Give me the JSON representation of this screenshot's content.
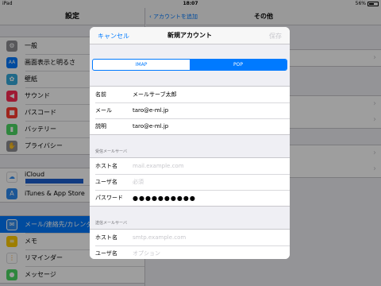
{
  "status_bar": {
    "device": "iPad",
    "time": "18:07",
    "battery": "56%"
  },
  "left_pane": {
    "title": "設定",
    "group1": [
      {
        "label": "一般",
        "icon": "gear-icon",
        "color": "#8e8e93"
      },
      {
        "label": "画面表示と明るさ",
        "icon": "brightness-icon",
        "color": "#007aff"
      },
      {
        "label": "壁紙",
        "icon": "wallpaper-icon",
        "color": "#34aadc"
      },
      {
        "label": "サウンド",
        "icon": "speaker-icon",
        "color": "#ff2d55"
      },
      {
        "label": "パスコード",
        "icon": "lock-icon",
        "color": "#ff3b30"
      },
      {
        "label": "バッテリー",
        "icon": "battery-icon",
        "color": "#4cd964"
      },
      {
        "label": "プライバシー",
        "icon": "hand-icon",
        "color": "#8e8e93"
      }
    ],
    "group2": [
      {
        "label": "iCloud",
        "icon": "cloud-icon",
        "color": "#ffffff"
      },
      {
        "label": "iTunes & App Store",
        "icon": "appstore-icon",
        "color": "#2e8cf0"
      }
    ],
    "group3": [
      {
        "label": "メール/連絡先/カレンダー",
        "icon": "mail-icon",
        "color": "#2e8cf0",
        "active": true
      },
      {
        "label": "メモ",
        "icon": "notes-icon",
        "color": "#ffcc00"
      },
      {
        "label": "リマインダー",
        "icon": "reminders-icon",
        "color": "#ffffff"
      },
      {
        "label": "メッセージ",
        "icon": "messages-icon",
        "color": "#4cd964"
      }
    ]
  },
  "right_pane": {
    "back_label": "アカウントを追加",
    "title": "その他"
  },
  "modal": {
    "cancel": "キャンセル",
    "title": "新規アカウント",
    "save": "保存",
    "segments": [
      "IMAP",
      "POP"
    ],
    "selected_segment": "POP",
    "account": [
      {
        "label": "名前",
        "value": "メールサーブ太郎"
      },
      {
        "label": "メール",
        "value": "taro@e-ml.jp"
      },
      {
        "label": "説明",
        "value": "taro@e-ml.jp"
      }
    ],
    "incoming_header": "受信メールサーバ",
    "incoming": {
      "host_label": "ホスト名",
      "host_placeholder": "mail.example.com",
      "user_label": "ユーザ名",
      "user_placeholder": "必須",
      "password_label": "パスワード",
      "password_value": "●●●●●●●●●●"
    },
    "outgoing_header": "送信メールサーバ",
    "outgoing": {
      "host_label": "ホスト名",
      "host_placeholder": "smtp.example.com",
      "user_label": "ユーザ名",
      "user_placeholder": "オプション"
    }
  }
}
